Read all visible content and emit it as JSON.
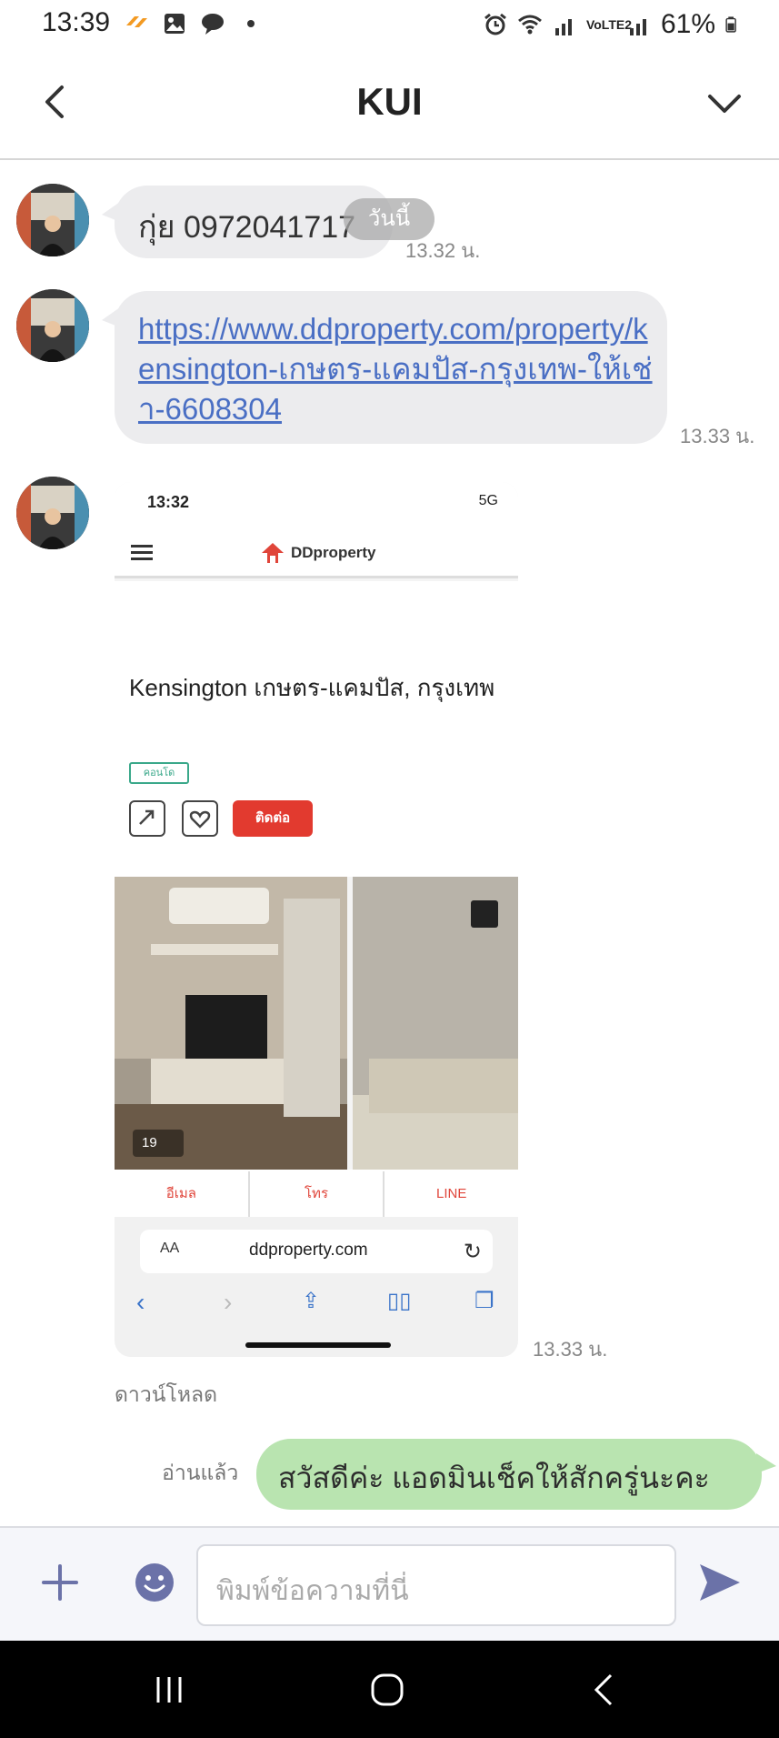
{
  "status_bar": {
    "time": "13:39",
    "battery": "61%",
    "network": "VoLTE2"
  },
  "header": {
    "title": "KUI"
  },
  "messages": [
    {
      "from": "KUI",
      "text": "กุ่ย 0972041717",
      "day_chip": "วันนี้",
      "time": "13.32 น."
    },
    {
      "from": "KUI",
      "link": "https://www.ddproperty.com/property/kensington-เกษตร-แคมปัส-กรุงเทพ-ให้เช่า-6608304",
      "time": "13.33 น."
    },
    {
      "from": "KUI",
      "type": "image",
      "time": "13.33 น.",
      "download_label": "ดาวน์โหลด",
      "screenshot": {
        "time": "13:32",
        "network": "5G",
        "logo_text": "DDproperty",
        "listing_title": "Kensington เกษตร-แคมปัส, กรุงเทพ",
        "tag": "คอนโด",
        "contact_button": "ติดต่อ",
        "photo_count": "19",
        "actions": [
          "อีเมล",
          "โทร",
          "LINE"
        ],
        "aa_label": "AA",
        "url": "ddproperty.com"
      }
    },
    {
      "from": "me",
      "text": "สวัสดีค่ะ แอดมินเช็คให้สักครู่นะคะ",
      "status": "อ่านแล้ว"
    }
  ],
  "input": {
    "placeholder": "พิมพ์ข้อความที่นี่"
  },
  "colors": {
    "incoming_bubble": "#ececee",
    "outgoing_bubble": "#b9e4b0",
    "link": "#4a6fc4",
    "icon": "#6b72a8"
  }
}
